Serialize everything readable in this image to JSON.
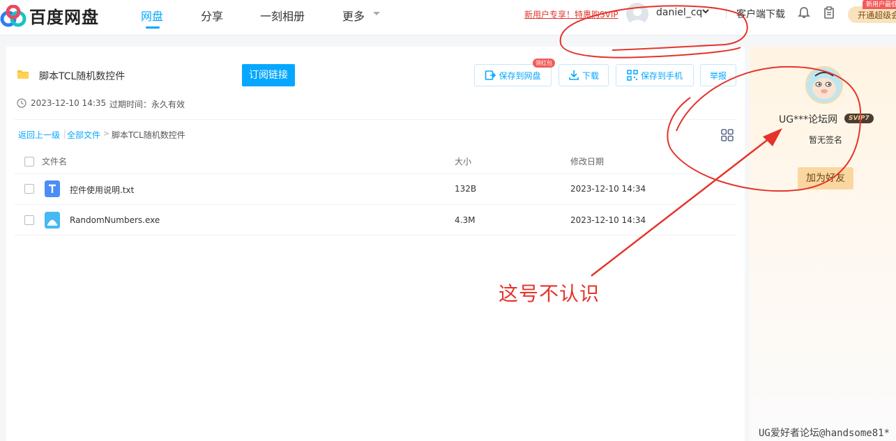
{
  "app": {
    "name": "百度网盘"
  },
  "nav": {
    "items": [
      "网盘",
      "分享",
      "一刻相册",
      "更多"
    ],
    "active": "网盘"
  },
  "header": {
    "promo": "新用户专享！特惠购SVIP",
    "username": "daniel_cq",
    "client_download": "客户端下载",
    "vip_button": "开通超级会员",
    "vip_badge": "新用户最低"
  },
  "share": {
    "folder_name": "脚本TCL随机数控件",
    "subscribe": "订阅链接",
    "actions": {
      "save": "保存到网盘",
      "save_badge": "领红包",
      "download": "下载",
      "save_phone": "保存到手机",
      "report": "举报"
    },
    "created": "2023-12-10 14:35",
    "expire": "过期时间：永久有效"
  },
  "breadcrumb": {
    "back": "返回上一级",
    "sep": "|",
    "all_files": "全部文件",
    "arrow": ">",
    "current": "脚本TCL随机数控件"
  },
  "table": {
    "headers": {
      "name": "文件名",
      "size": "大小",
      "date": "修改日期"
    },
    "rows": [
      {
        "name": "控件使用说明.txt",
        "size": "132B",
        "date": "2023-12-10 14:34",
        "icon": "txt-file-icon"
      },
      {
        "name": "RandomNumbers.exe",
        "size": "4.3M",
        "date": "2023-12-10 14:34",
        "icon": "exe-file-icon"
      }
    ]
  },
  "sidebar": {
    "name": "UG***论坛网",
    "badge": "SVIP7",
    "signature": "暂无签名",
    "add_friend": "加为好友"
  },
  "annotation": {
    "text": "这号不认识",
    "color": "#e5332a"
  },
  "watermark": "UG爱好者论坛@handsome81*",
  "colors": {
    "accent": "#06a7ff",
    "annotation": "#e5332a",
    "vip_gold": "#fad7a0"
  }
}
